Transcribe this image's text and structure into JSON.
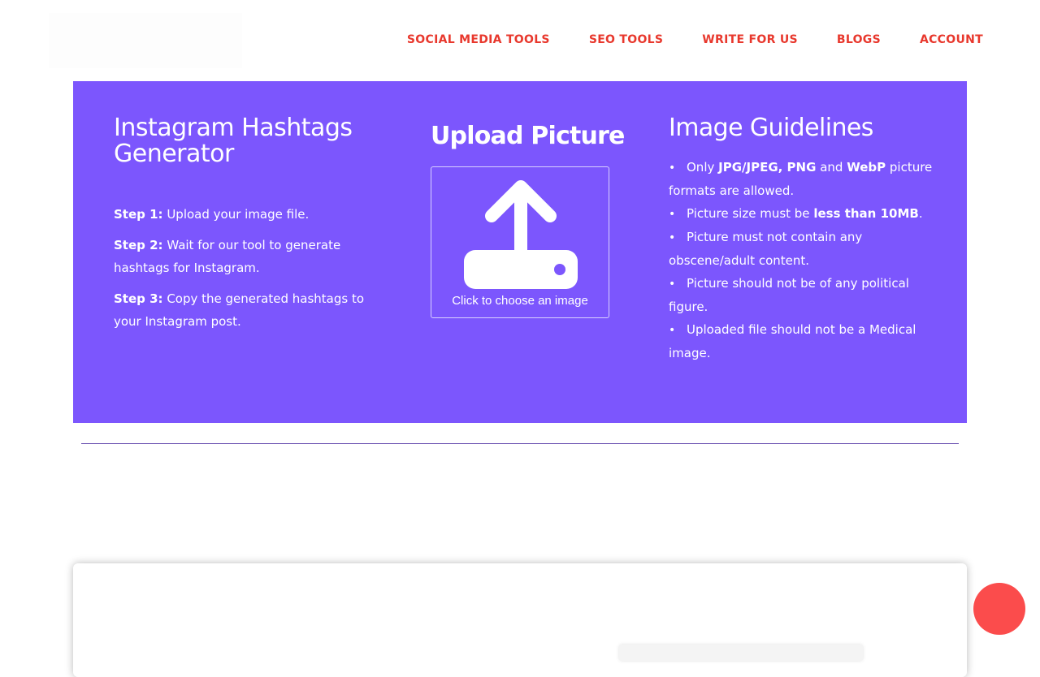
{
  "nav": {
    "items": [
      "SOCIAL MEDIA TOOLS",
      "SEO TOOLS",
      "WRITE FOR US",
      "BLOGS",
      "ACCOUNT"
    ]
  },
  "left": {
    "title": "Instagram Hashtags Generator",
    "steps": [
      {
        "label": "Step 1:",
        "text": "Upload your image file."
      },
      {
        "label": "Step 2:",
        "text": "Wait for our tool to generate hashtags for Instagram."
      },
      {
        "label": "Step 3:",
        "text": "Copy the generated hashtags to your Instagram post."
      }
    ]
  },
  "upload": {
    "title": "Upload Picture",
    "caption": "Click to choose an image",
    "icon": "upload-icon"
  },
  "guidelines": {
    "title": "Image Guidelines",
    "bullet": "•",
    "g1": {
      "a": "Only ",
      "b": "JPG/JPEG, PNG",
      "c": " and ",
      "d": "WebP",
      "e": " picture formats are allowed."
    },
    "g2": {
      "a": "Picture size must be ",
      "b": "less than 10MB",
      "c": "."
    },
    "g3": "Picture must not contain any obscene/adult content.",
    "g4": "Picture should not be of any political figure.",
    "g5": "Uploaded file should not be a Medical image."
  },
  "colors": {
    "hero": "#7c56fd",
    "nav": "#e8382d",
    "fab": "#fb4c4c"
  }
}
